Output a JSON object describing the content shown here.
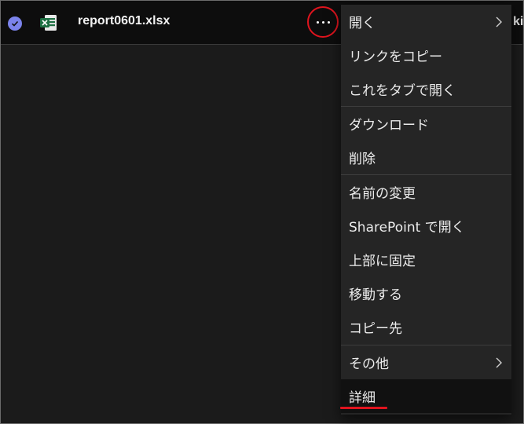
{
  "file": {
    "name": "report0601.xlsx",
    "trailing_text": "kir"
  },
  "menu": {
    "items": [
      {
        "label": "開く",
        "has_submenu": true
      },
      {
        "label": "リンクをコピー",
        "has_submenu": false
      },
      {
        "label": "これをタブで開く",
        "has_submenu": false
      },
      {
        "label": "ダウンロード",
        "has_submenu": false
      },
      {
        "label": "削除",
        "has_submenu": false
      },
      {
        "label": "名前の変更",
        "has_submenu": false
      },
      {
        "label": "SharePoint で開く",
        "has_submenu": false
      },
      {
        "label": "上部に固定",
        "has_submenu": false
      },
      {
        "label": "移動する",
        "has_submenu": false
      },
      {
        "label": "コピー先",
        "has_submenu": false
      },
      {
        "label": "その他",
        "has_submenu": true
      },
      {
        "label": "詳細",
        "has_submenu": false
      }
    ]
  },
  "colors": {
    "accent": "#7b83eb",
    "highlight": "#e0141e",
    "excel_green": "#1d6f42"
  }
}
